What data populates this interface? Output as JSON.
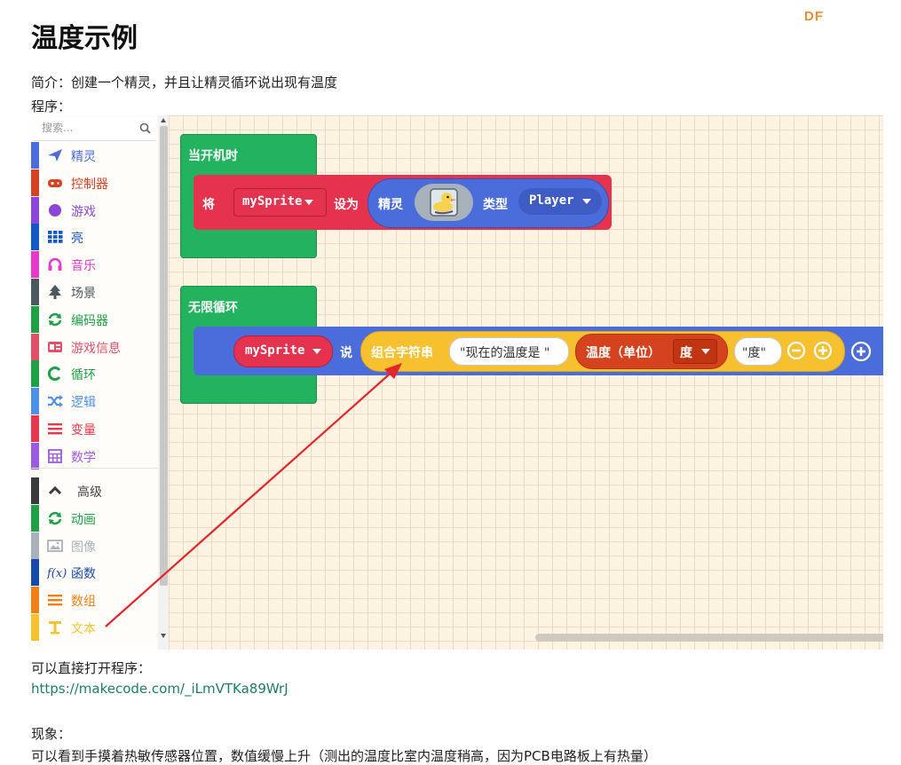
{
  "page": {
    "logo": "DF",
    "title": "温度示例",
    "intro": "简介：创建一个精灵，并且让精灵循环说出现有温度",
    "program_label": "程序：",
    "open_label": "可以直接打开程序：",
    "link": "https://makecode.com/_iLmVTKa89WrJ",
    "phenomenon_label": "现象：",
    "phenomenon_text": "可以看到手摸着热敏传感器位置，数值缓慢上升（测出的温度比室内温度稍高，因为PCB电路板上有热量）"
  },
  "toolbox": {
    "search_placeholder": "搜索...",
    "categories": [
      {
        "label": "精灵",
        "icon": "paper-plane-icon",
        "color": "#4b6cdb"
      },
      {
        "label": "控制器",
        "icon": "gamepad-icon",
        "color": "#d54322"
      },
      {
        "label": "游戏",
        "icon": "circle-icon",
        "color": "#8b48d8"
      },
      {
        "label": "亮",
        "icon": "grid-icon",
        "color": "#1358c4"
      },
      {
        "label": "音乐",
        "icon": "headphones-icon",
        "color": "#e63bc8"
      },
      {
        "label": "场景",
        "icon": "tree-icon",
        "color": "#4b585e"
      },
      {
        "label": "编码器",
        "icon": "refresh-icon",
        "color": "#1fa047"
      },
      {
        "label": "游戏信息",
        "icon": "id-card-icon",
        "color": "#e0506a"
      },
      {
        "label": "循环",
        "icon": "loop-icon",
        "color": "#1fa047"
      },
      {
        "label": "逻辑",
        "icon": "shuffle-icon",
        "color": "#4d91e8"
      },
      {
        "label": "变量",
        "icon": "list-icon",
        "color": "#e8364f"
      },
      {
        "label": "数学",
        "icon": "calculator-icon",
        "color": "#9c5ae0"
      },
      {
        "label": "高级",
        "icon": "chevron-up-icon",
        "color": "#3a3a3a"
      },
      {
        "label": "动画",
        "icon": "refresh-icon",
        "color": "#1fa047"
      },
      {
        "label": "图像",
        "icon": "image-icon",
        "color": "#a9b2ba"
      },
      {
        "label": "函数",
        "icon": "function-icon",
        "color": "#1a4aa8"
      },
      {
        "label": "数组",
        "icon": "list-icon",
        "color": "#f57f17"
      },
      {
        "label": "文本",
        "icon": "text-icon",
        "color": "#f4c332"
      }
    ]
  },
  "blocks": {
    "on_start": "当开机时",
    "set_word": "将",
    "sprite_var": "mySprite",
    "set_to": "设为",
    "sprite_word": "精灵",
    "kind_word": "类型",
    "kind_value": "Player",
    "forever": "无限循环",
    "say_var": "mySprite",
    "say_word": "说",
    "join_word": "组合字符串",
    "string1": "\"现在的温度是 \"",
    "temp_word": "温度（单位）",
    "temp_unit": "度",
    "string2": "\"度\""
  },
  "colors": {
    "event_green": "#23b35e",
    "sprite_red": "#e5334f",
    "sprite_blue": "#4b6cdb",
    "text_yellow": "#f6c02f",
    "sensor_orange": "#d5421e",
    "loop_blue": "#4b6cdb",
    "workspace": "#fdf3e2",
    "arrow": "#e5252a"
  }
}
